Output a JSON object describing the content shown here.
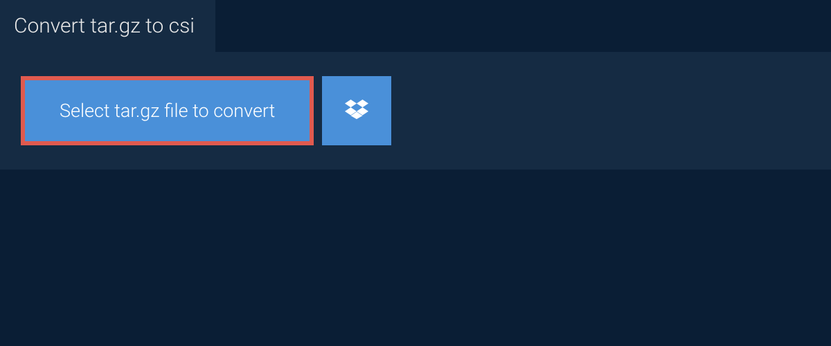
{
  "header": {
    "title": "Convert tar.gz to csi"
  },
  "actions": {
    "select_file_label": "Select tar.gz file to convert",
    "dropbox_icon": "dropbox"
  },
  "colors": {
    "background": "#0a1e35",
    "panel": "#152b43",
    "button": "#4a90d9",
    "button_border": "#e05a4f"
  }
}
